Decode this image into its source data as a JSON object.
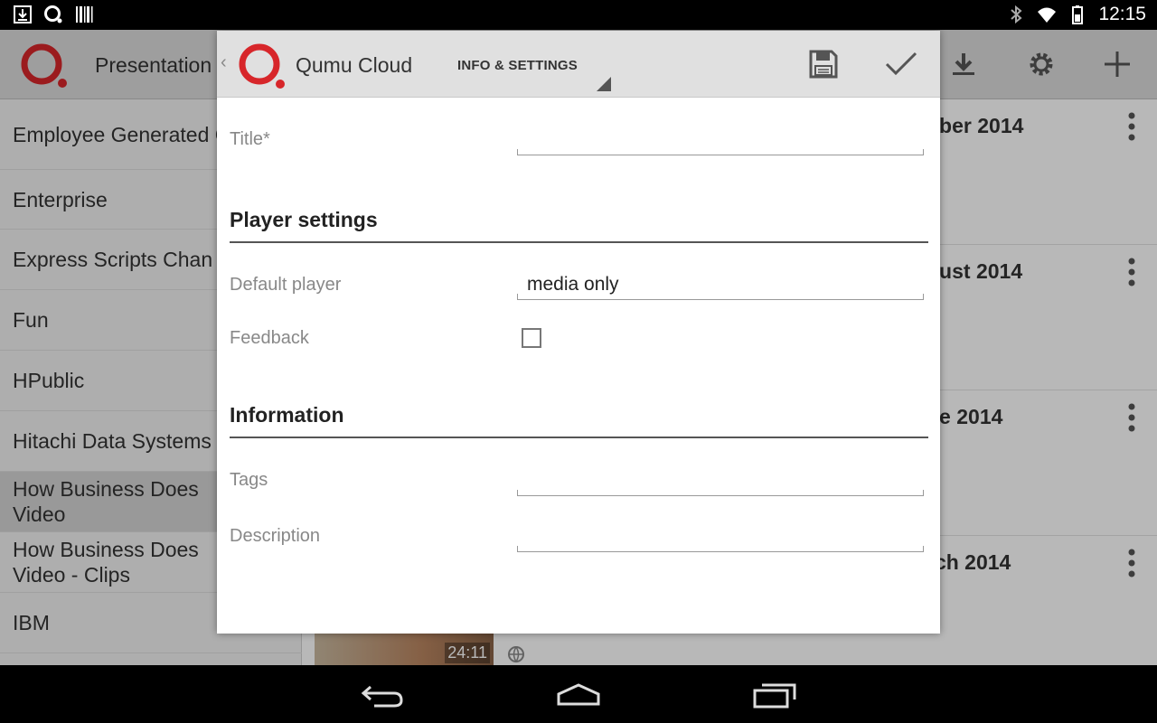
{
  "status_bar": {
    "time": "12:15",
    "icons": [
      "download-icon",
      "qumu-notification-icon",
      "barcode-icon",
      "bluetooth-icon",
      "wifi-icon",
      "battery-icon"
    ]
  },
  "background": {
    "app_title": "Presentation",
    "actions": [
      "download-icon",
      "gear-icon",
      "add-icon"
    ],
    "sidebar_items": [
      {
        "label": "Employee Generated Content",
        "selected": false
      },
      {
        "label": "Enterprise",
        "selected": false
      },
      {
        "label": "Express Scripts Chan",
        "selected": false
      },
      {
        "label": "Fun",
        "selected": false
      },
      {
        "label": "HPublic",
        "selected": false
      },
      {
        "label": "Hitachi Data Systems",
        "selected": false
      },
      {
        "label": "How Business Does Video",
        "selected": true
      },
      {
        "label": "How Business Does Video - Clips",
        "selected": false
      },
      {
        "label": "IBM",
        "selected": false
      }
    ],
    "rows": [
      {
        "date": "ober 2014"
      },
      {
        "date": "gust 2014"
      },
      {
        "date": "ne 2014"
      },
      {
        "date": "rch 2014"
      }
    ],
    "thumb_duration": "24:11"
  },
  "dialog": {
    "back_glyph": "‹",
    "app_name": "Qumu Cloud",
    "tab_label": "INFO & SETTINGS",
    "title_label": "Title*",
    "title_value": "",
    "player_section": "Player settings",
    "default_player_label": "Default player",
    "default_player_value": "media only",
    "feedback_label": "Feedback",
    "feedback_checked": false,
    "info_section": "Information",
    "tags_label": "Tags",
    "tags_value": "",
    "description_label": "Description",
    "description_value": ""
  },
  "colors": {
    "brand_red": "#d7262a",
    "appbar_bg": "#dcdcdc",
    "dialog_bar_bg": "#e0e0e0"
  }
}
